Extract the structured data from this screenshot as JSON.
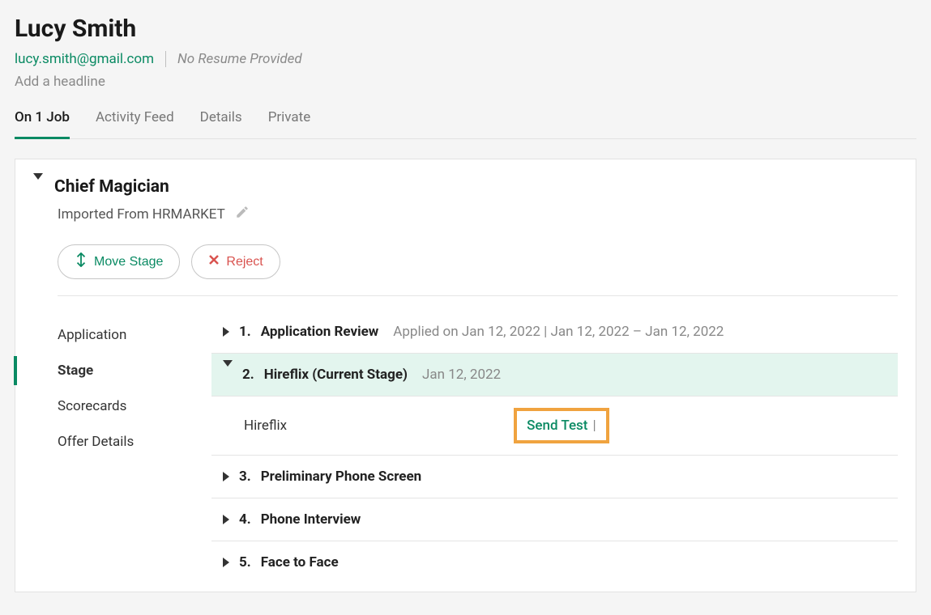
{
  "candidate": {
    "name": "Lucy Smith",
    "email": "lucy.smith@gmail.com",
    "no_resume": "No Resume Provided",
    "headline_placeholder": "Add a headline"
  },
  "tabs": {
    "on_job": "On 1 Job",
    "activity": "Activity Feed",
    "details": "Details",
    "private": "Private"
  },
  "job": {
    "title": "Chief Magician",
    "imported": "Imported From HRMARKET",
    "move_stage": "Move Stage",
    "reject": "Reject"
  },
  "sidenav": {
    "application": "Application",
    "stage": "Stage",
    "scorecards": "Scorecards",
    "offer": "Offer Details"
  },
  "stages": {
    "s1_num": "1.",
    "s1_name": "Application Review",
    "s1_meta": "Applied on Jan 12, 2022 | Jan 12, 2022 – Jan 12, 2022",
    "s2_num": "2.",
    "s2_name": "Hireflix (Current Stage)",
    "s2_meta": "Jan 12, 2022",
    "s2_sub_label": "Hireflix",
    "s2_send_test": "Send Test",
    "s2_pipe": "|",
    "s3_num": "3.",
    "s3_name": "Preliminary Phone Screen",
    "s4_num": "4.",
    "s4_name": "Phone Interview",
    "s5_num": "5.",
    "s5_name": "Face to Face"
  }
}
